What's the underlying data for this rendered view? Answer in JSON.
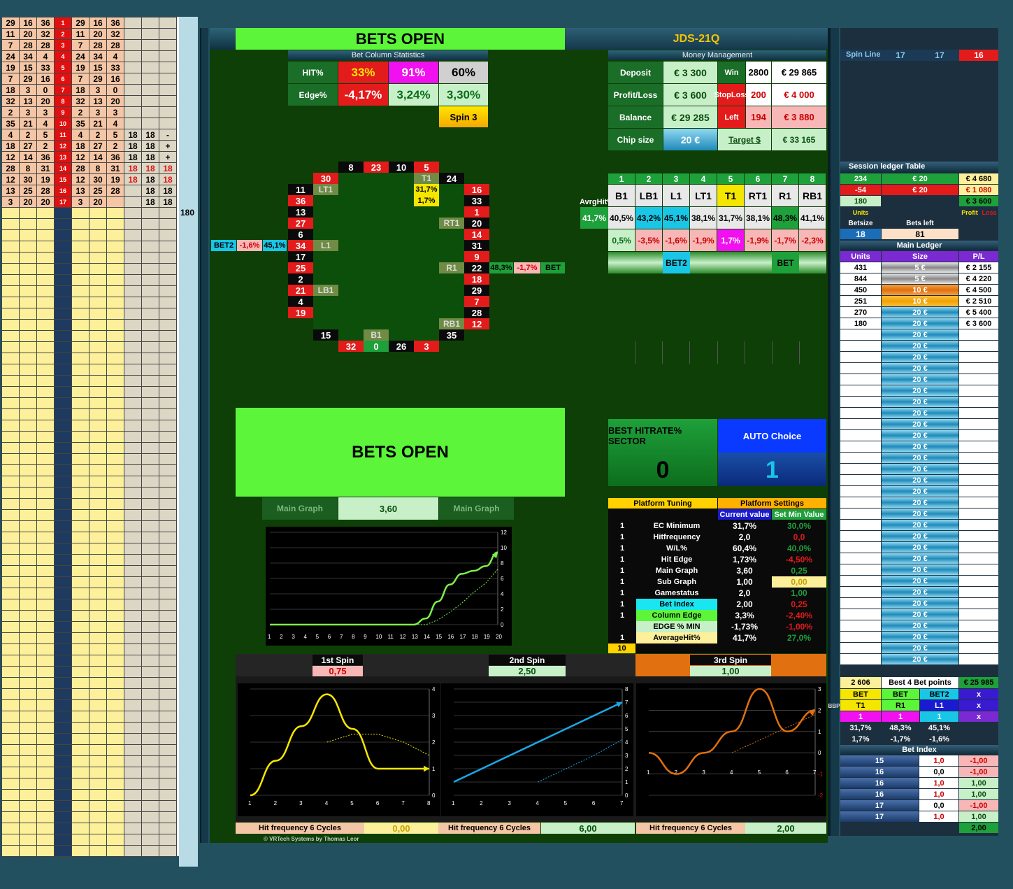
{
  "left_rows": [
    [
      "29",
      "16",
      "36",
      "1",
      "29",
      "16",
      "36",
      "",
      "",
      ""
    ],
    [
      "11",
      "20",
      "32",
      "2",
      "11",
      "20",
      "32",
      "",
      "",
      ""
    ],
    [
      "7",
      "28",
      "28",
      "3",
      "7",
      "28",
      "28",
      "",
      "",
      ""
    ],
    [
      "24",
      "34",
      "4",
      "4",
      "24",
      "34",
      "4",
      "",
      "",
      ""
    ],
    [
      "19",
      "15",
      "33",
      "5",
      "19",
      "15",
      "33",
      "",
      "",
      ""
    ],
    [
      "7",
      "29",
      "16",
      "6",
      "7",
      "29",
      "16",
      "",
      "",
      ""
    ],
    [
      "18",
      "3",
      "0",
      "7",
      "18",
      "3",
      "0",
      "",
      "",
      ""
    ],
    [
      "32",
      "13",
      "20",
      "8",
      "32",
      "13",
      "20",
      "",
      "",
      ""
    ],
    [
      "2",
      "3",
      "3",
      "9",
      "2",
      "3",
      "3",
      "",
      "",
      ""
    ],
    [
      "35",
      "21",
      "4",
      "10",
      "35",
      "21",
      "4",
      "",
      "",
      ""
    ],
    [
      "4",
      "2",
      "5",
      "11",
      "4",
      "2",
      "5",
      "18",
      "18",
      "-"
    ],
    [
      "18",
      "27",
      "2",
      "12",
      "18",
      "27",
      "2",
      "18",
      "18",
      "+"
    ],
    [
      "12",
      "14",
      "36",
      "13",
      "12",
      "14",
      "36",
      "18",
      "18",
      "+"
    ],
    [
      "28",
      "8",
      "31",
      "14",
      "28",
      "8",
      "31",
      "18",
      "18",
      "18"
    ],
    [
      "12",
      "30",
      "19",
      "15",
      "12",
      "30",
      "19",
      "18",
      "18",
      "18"
    ],
    [
      "13",
      "25",
      "28",
      "16",
      "13",
      "25",
      "28",
      "",
      "18",
      "18"
    ],
    [
      "3",
      "20",
      "20",
      "17",
      "3",
      "20",
      "",
      "",
      "18",
      "18"
    ]
  ],
  "sidebar_value": "180",
  "top_banner": {
    "bets_open": "BETS OPEN",
    "title": "JDS-21Q"
  },
  "bet_column_stats": {
    "header": "Bet Column Statistics",
    "hit_label": "HIT%",
    "hit_values": [
      "33%",
      "91%",
      "60%"
    ],
    "edge_label": "Edge%",
    "edge_values": [
      "-4,17%",
      "3,24%",
      "3,30%"
    ],
    "spin_label": "Spin 3"
  },
  "money": {
    "header": "Money Management",
    "deposit_label": "Deposit",
    "deposit": "€ 3 300",
    "win_label": "Win",
    "win": "2800",
    "win_amt": "€ 29 865",
    "pl_label": "Profit/Loss",
    "pl": "€ 3 600",
    "stoploss_label": "StopLoss",
    "stoploss": "200",
    "stoploss_amt": "€ 4 000",
    "balance_label": "Balance",
    "balance": "€ 29 285",
    "left_label": "Left",
    "left": "194",
    "left_amt": "€ 3 880",
    "chip_label": "Chip size",
    "chip": "20 €",
    "target_label": "Target $",
    "target": "€ 33 165"
  },
  "wheel": {
    "top": [
      "8",
      "23",
      "10",
      "5"
    ],
    "top_colors": [
      "b",
      "r",
      "b",
      "r"
    ],
    "left": [
      "30",
      "11",
      "36",
      "13",
      "27",
      "6",
      "34",
      "17",
      "25",
      "2",
      "21",
      "4",
      "19"
    ],
    "left_colors": [
      "r",
      "b",
      "r",
      "b",
      "r",
      "b",
      "r",
      "b",
      "r",
      "b",
      "r",
      "b",
      "r"
    ],
    "right": [
      "24",
      "16",
      "33",
      "1",
      "20",
      "14",
      "31",
      "9",
      "22",
      "18",
      "29",
      "7",
      "28",
      "12"
    ],
    "right_colors": [
      "b",
      "r",
      "b",
      "r",
      "b",
      "r",
      "b",
      "r",
      "b",
      "r",
      "b",
      "r",
      "b",
      "r"
    ],
    "bottom": [
      "15",
      "32",
      "0",
      "26",
      "3",
      "35"
    ],
    "bottom_colors": [
      "b",
      "r",
      "g",
      "b",
      "r",
      "b"
    ],
    "labels": {
      "lt1": "LT1",
      "t1": "T1",
      "t1_pct1": "31,7%",
      "t1_pct2": "1,7%",
      "rt1": "RT1",
      "l1": "L1",
      "r1": "R1",
      "lb1": "LB1",
      "rb1": "RB1",
      "b1": "B1"
    },
    "bet2_label": "BET2",
    "bet2_edge": "-1,6%",
    "bet2_hit": "45,1%",
    "bet_label": "BET",
    "bet_hit": "48,3%",
    "bet_edge": "-1,7%"
  },
  "sectors": {
    "nums": [
      "1",
      "2",
      "3",
      "4",
      "5",
      "6",
      "7",
      "8"
    ],
    "names": [
      "B1",
      "LB1",
      "L1",
      "LT1",
      "T1",
      "RT1",
      "R1",
      "RB1"
    ],
    "avrg_label": "AvrgHit%",
    "avrg": "41,7%",
    "hits": [
      "40,5%",
      "43,2%",
      "45,1%",
      "38,1%",
      "31,7%",
      "38,1%",
      "48,3%",
      "41,1%"
    ],
    "edges": [
      "0,5%",
      "-3,5%",
      "-1,6%",
      "-1,9%",
      "1,7%",
      "-1,9%",
      "-1,7%",
      "-2,3%"
    ],
    "bet2": "BET2",
    "bet": "BET"
  },
  "bets_open_big": "BETS OPEN",
  "main_graph": {
    "label_left": "Main Graph",
    "value": "3,60",
    "label_right": "Main Graph"
  },
  "best_sector": {
    "title": "BEST HITRATE% SECTOR",
    "value": "0",
    "auto_title": "AUTO Choice",
    "auto_value": "1"
  },
  "platform": {
    "tuning": "Platform Tuning",
    "settings": "Platform Settings",
    "current": "Current value",
    "setmin": "Set Min Value",
    "rows": [
      {
        "flag": "1",
        "name": "EC Minimum",
        "cur": "31,7%",
        "min": "30,0%"
      },
      {
        "flag": "1",
        "name": "Hitfrequency",
        "cur": "2,0",
        "min": "0,0"
      },
      {
        "flag": "1",
        "name": "W/L%",
        "cur": "60,4%",
        "min": "40,0%"
      },
      {
        "flag": "1",
        "name": "Hit Edge",
        "cur": "1,73%",
        "min": "-4,50%"
      },
      {
        "flag": "1",
        "name": "Main Graph",
        "cur": "3,60",
        "min": "0,25"
      },
      {
        "flag": "1",
        "name": "Sub Graph",
        "cur": "1,00",
        "min": "0,00"
      },
      {
        "flag": "1",
        "name": "Gamestatus",
        "cur": "2,0",
        "min": "1,00"
      },
      {
        "flag": "1",
        "name": "Bet Index",
        "cur": "2,00",
        "min": "0,25"
      },
      {
        "flag": "1",
        "name": "Column Edge",
        "cur": "3,3%",
        "min": "-2,40%"
      },
      {
        "flag": "",
        "name": "EDGE % MIN",
        "cur": "-1,73%",
        "min": "-1,00%"
      },
      {
        "flag": "1",
        "name": "AverageHit%",
        "cur": "41,7%",
        "min": "27,0%"
      }
    ],
    "total": "10"
  },
  "spins": [
    {
      "label": "1st Spin",
      "value": "0,75",
      "hf_label": "Hit frequency 6 Cycles",
      "hf": "0,00"
    },
    {
      "label": "2nd Spin",
      "value": "2,50",
      "hf_label": "Hit frequency 6 Cycles",
      "hf": "6,00"
    },
    {
      "label": "3rd Spin",
      "value": "1,00",
      "hf_label": "Hit frequency 6 Cycles",
      "hf": "2,00"
    }
  ],
  "copyright": "© VRTech Systems by Thomas Leor",
  "right": {
    "spin_line_label": "Spin Line",
    "spin_line": [
      "17",
      "17",
      "16"
    ],
    "session_header": "Session ledger Table",
    "session_rows": [
      [
        "234",
        "€ 20",
        "€ 4 680"
      ],
      [
        "-54",
        "€ 20",
        "€ 1 080"
      ],
      [
        "180",
        "",
        "€ 3 600"
      ]
    ],
    "units_label": "Units",
    "profit_label": "Profit",
    "loss_label": "Loss",
    "betsize_label": "Betsize",
    "betsleft_label": "Bets left",
    "betsize": "18",
    "betsleft": "81",
    "main_ledger": "Main Ledger",
    "ledger_cols": [
      "Units",
      "Size",
      "P/L"
    ],
    "ledger_rows": [
      [
        "431",
        "5 €",
        "€ 2 155"
      ],
      [
        "844",
        "5 €",
        "€ 4 220"
      ],
      [
        "450",
        "10 €",
        "€ 4 500"
      ],
      [
        "251",
        "10 €",
        "€ 2 510"
      ],
      [
        "270",
        "20 €",
        "€ 5 400"
      ],
      [
        "180",
        "20 €",
        "€ 3 600"
      ]
    ],
    "filler_size": "20 €",
    "totals": [
      "2 606",
      "Best 4 Bet points",
      "€ 25 985"
    ],
    "bbp_label": "BBP",
    "bbp_row1": [
      "BET",
      "BET",
      "BET2",
      "x"
    ],
    "bbp_row2": [
      "T1",
      "R1",
      "L1",
      "x"
    ],
    "bbp_row3": [
      "1",
      "1",
      "1",
      "x"
    ],
    "bbp_row4": [
      "31,7%",
      "48,3%",
      "45,1%"
    ],
    "bbp_row5": [
      "1,7%",
      "-1,7%",
      "-1,6%"
    ],
    "bet_index_label": "Bet Index",
    "bet_index_rows": [
      [
        "15",
        "1,0",
        "-1,00"
      ],
      [
        "16",
        "0,0",
        "-1,00"
      ],
      [
        "16",
        "1,0",
        "1,00"
      ],
      [
        "16",
        "1,0",
        "1,00"
      ],
      [
        "17",
        "0,0",
        "-1,00"
      ],
      [
        "17",
        "1,0",
        "1,00"
      ]
    ],
    "bet_index_total": "2,00"
  },
  "chart_data": [
    {
      "type": "line",
      "title": "",
      "x": [
        1,
        2,
        3,
        4,
        5,
        6,
        7,
        8,
        9,
        10,
        11,
        12,
        13,
        14,
        15,
        16,
        17,
        18,
        19,
        20
      ],
      "series": [
        {
          "values": [
            0,
            0,
            0,
            0,
            0,
            0,
            0,
            0,
            0,
            0,
            0,
            0,
            0,
            0.8,
            3,
            5.2,
            6.6,
            7,
            7.6,
            9.4
          ]
        },
        {
          "values": [
            0,
            0,
            0,
            0,
            0,
            0,
            0,
            0,
            0,
            0,
            0,
            0,
            0,
            0,
            0.6,
            1.6,
            2.8,
            4.2,
            5.4,
            7.2
          ]
        }
      ],
      "ylim": [
        0,
        12
      ],
      "yticks": [
        0,
        2,
        4,
        6,
        8,
        10,
        12
      ]
    },
    {
      "type": "line",
      "x": [
        1,
        2,
        3,
        4,
        5,
        6,
        7,
        8
      ],
      "series": [
        {
          "values": [
            0,
            1.3,
            2.6,
            3.8,
            2.5,
            1,
            1,
            1
          ]
        },
        {
          "values": [
            null,
            null,
            null,
            2,
            2.3,
            2.3,
            2,
            1.5
          ]
        }
      ],
      "ylim": [
        0,
        4
      ]
    },
    {
      "type": "line",
      "x": [
        1,
        2,
        3,
        4,
        5,
        6,
        7
      ],
      "series": [
        {
          "values": [
            1,
            2,
            3,
            4,
            5,
            6,
            7
          ]
        },
        {
          "values": [
            null,
            null,
            null,
            1,
            2,
            3,
            4.2
          ]
        }
      ],
      "ylim": [
        0,
        8
      ]
    },
    {
      "type": "line",
      "x": [
        1,
        2,
        3,
        4,
        5,
        6,
        7
      ],
      "series": [
        {
          "values": [
            0,
            -1,
            0,
            1,
            3,
            1,
            2
          ]
        },
        {
          "values": [
            null,
            null,
            null,
            0,
            0.6,
            1.2,
            1.8
          ]
        }
      ],
      "ylim": [
        -2,
        3
      ]
    }
  ],
  "colors": {
    "lime": "#5cf53a",
    "main_bg": "#0e3f07",
    "red": "#e31b1b"
  }
}
